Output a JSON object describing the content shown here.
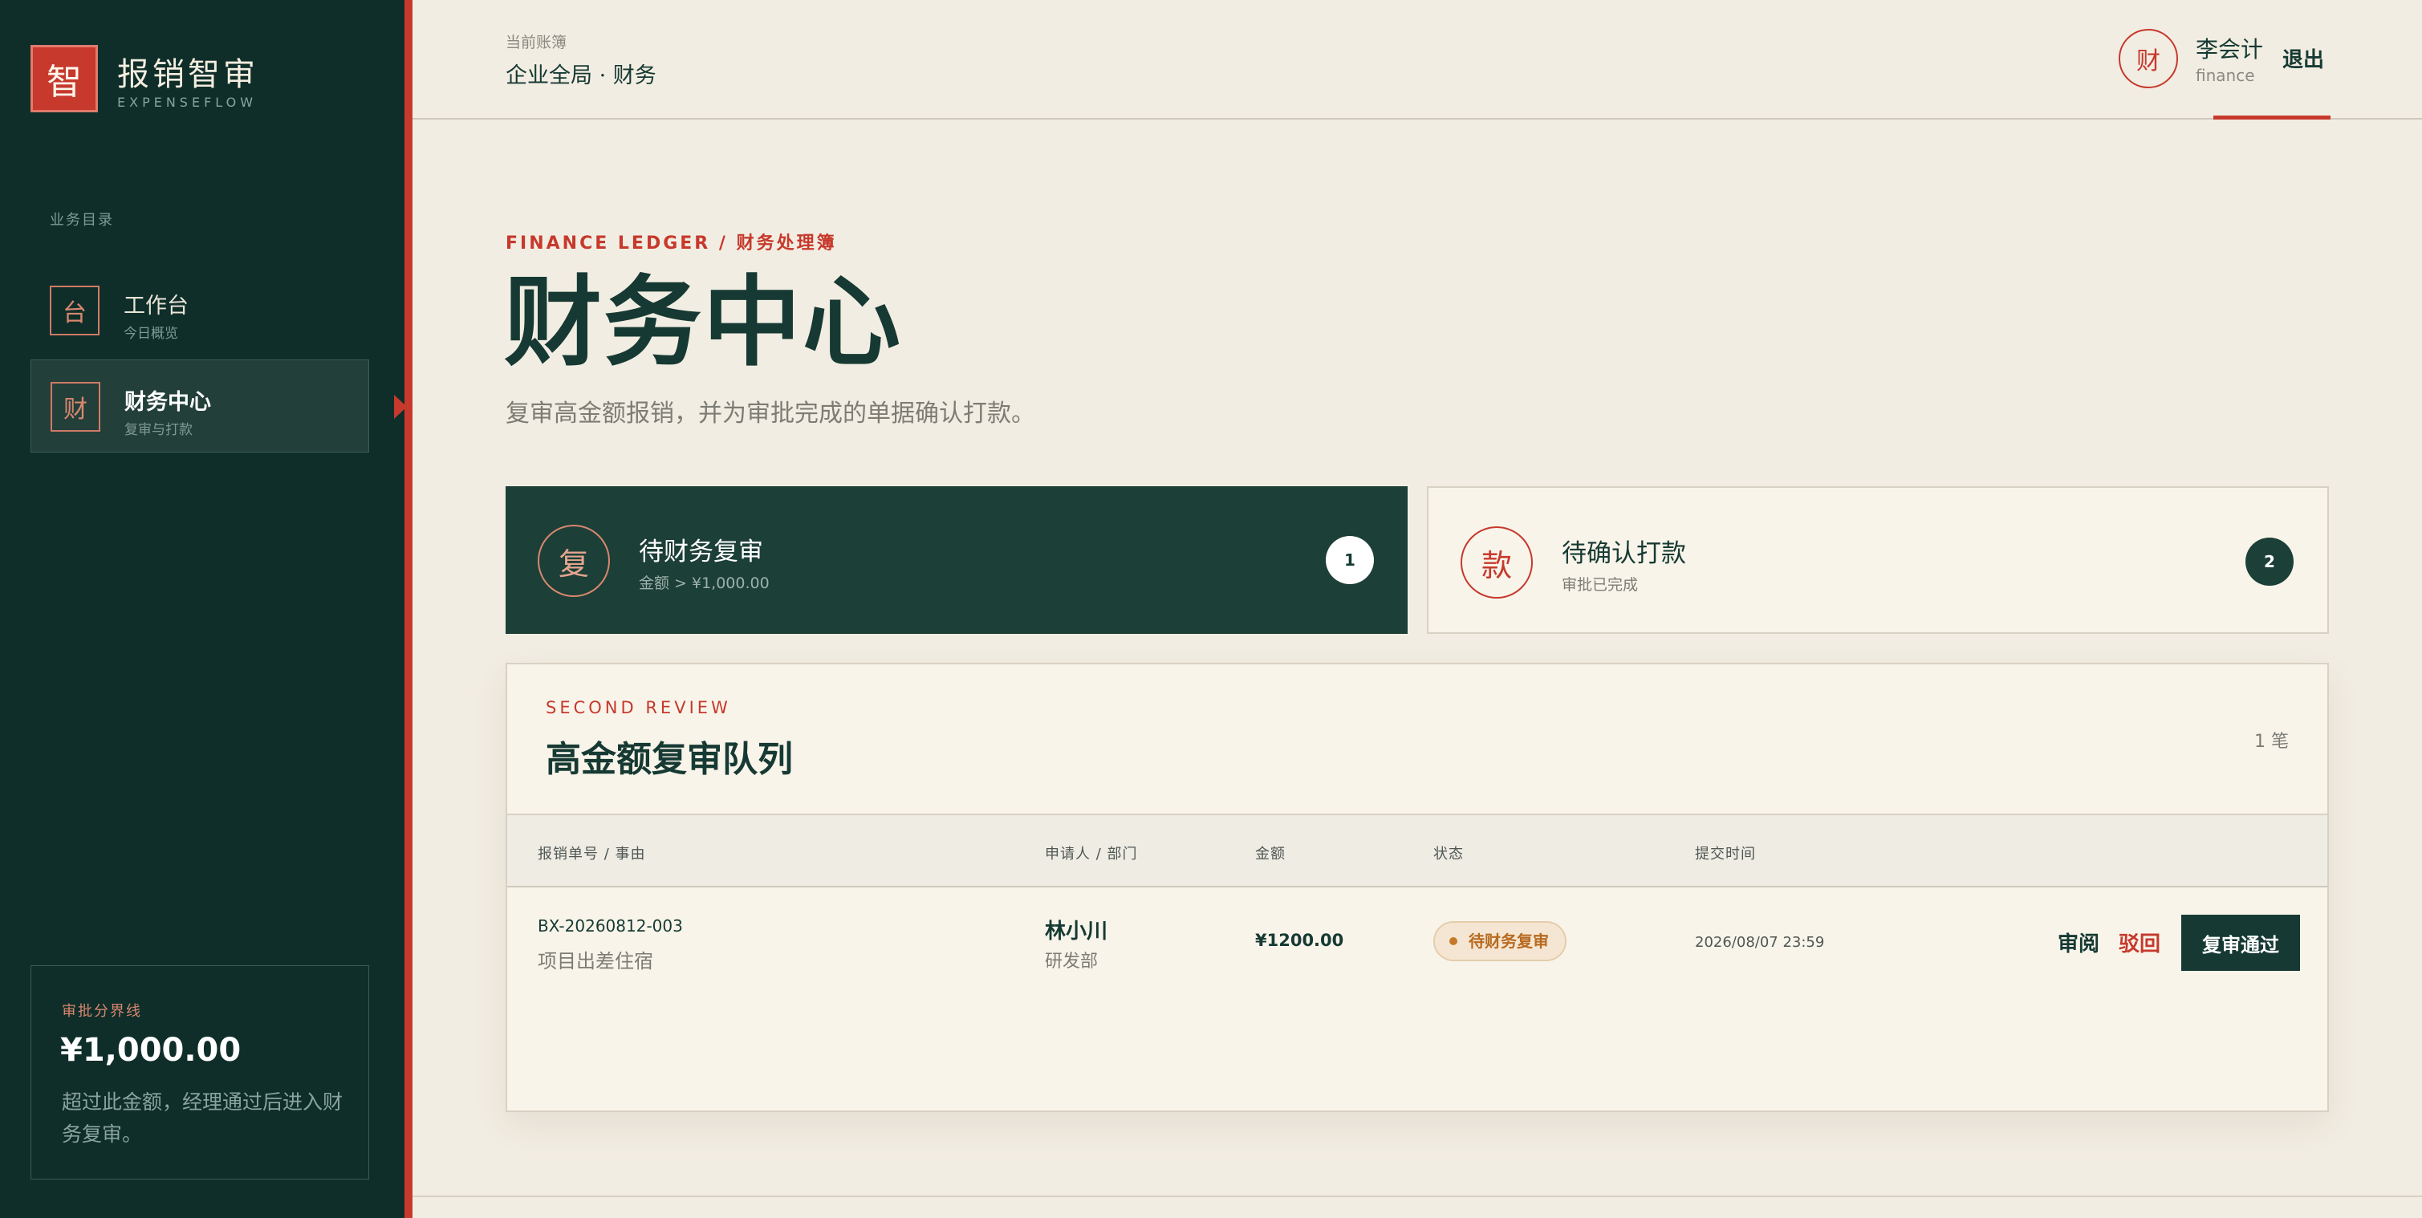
{
  "sidebar": {
    "brand": {
      "logo_char": "智",
      "name": "报销智审",
      "sub": "EXPENSEFLOW"
    },
    "nav_caption": "业务目录",
    "items": [
      {
        "icon_char": "台",
        "title": "工作台",
        "sub": "今日概览",
        "active": false
      },
      {
        "icon_char": "财",
        "title": "财务中心",
        "sub": "复审与打款",
        "active": true
      }
    ],
    "threshold": {
      "label": "审批分界线",
      "value": "¥1,000.00",
      "desc": "超过此金额，经理通过后进入财务复审。"
    }
  },
  "topbar": {
    "ledger_caption": "当前账簿",
    "ledger_name": "企业全局 · 财务",
    "user": {
      "avatar_char": "财",
      "name": "李会计",
      "role": "finance"
    },
    "logout_label": "退出"
  },
  "header": {
    "eyebrow": "FINANCE LEDGER / 财务处理簿",
    "title": "财务中心",
    "desc": "复审高金额报销，并为审批完成的单据确认打款。"
  },
  "stats": [
    {
      "icon_char": "复",
      "title": "待财务复审",
      "sub": "金额 > ¥1,000.00",
      "count": "1"
    },
    {
      "icon_char": "款",
      "title": "待确认打款",
      "sub": "审批已完成",
      "count": "2"
    }
  ],
  "queue": {
    "eyebrow": "SECOND REVIEW",
    "title": "高金额复审队列",
    "count": "1 笔",
    "columns": [
      "报销单号 / 事由",
      "申请人 / 部门",
      "金额",
      "状态",
      "提交时间"
    ],
    "rows": [
      {
        "id": "BX-20260812-003",
        "reason": "项目出差住宿",
        "applicant": "林小川",
        "dept": "研发部",
        "amount": "¥1200.00",
        "status": "待财务复审",
        "submitted": "2026/08/07 23:59",
        "actions": {
          "review": "审阅",
          "reject": "驳回",
          "approve": "复审通过"
        }
      }
    ]
  },
  "colors": {
    "sidebar_bg": "#0f2e29",
    "accent_red": "#c6392c",
    "dark_green": "#163a33",
    "page_bg": "#f2ede2",
    "badge_bg": "#f4e6d2"
  }
}
